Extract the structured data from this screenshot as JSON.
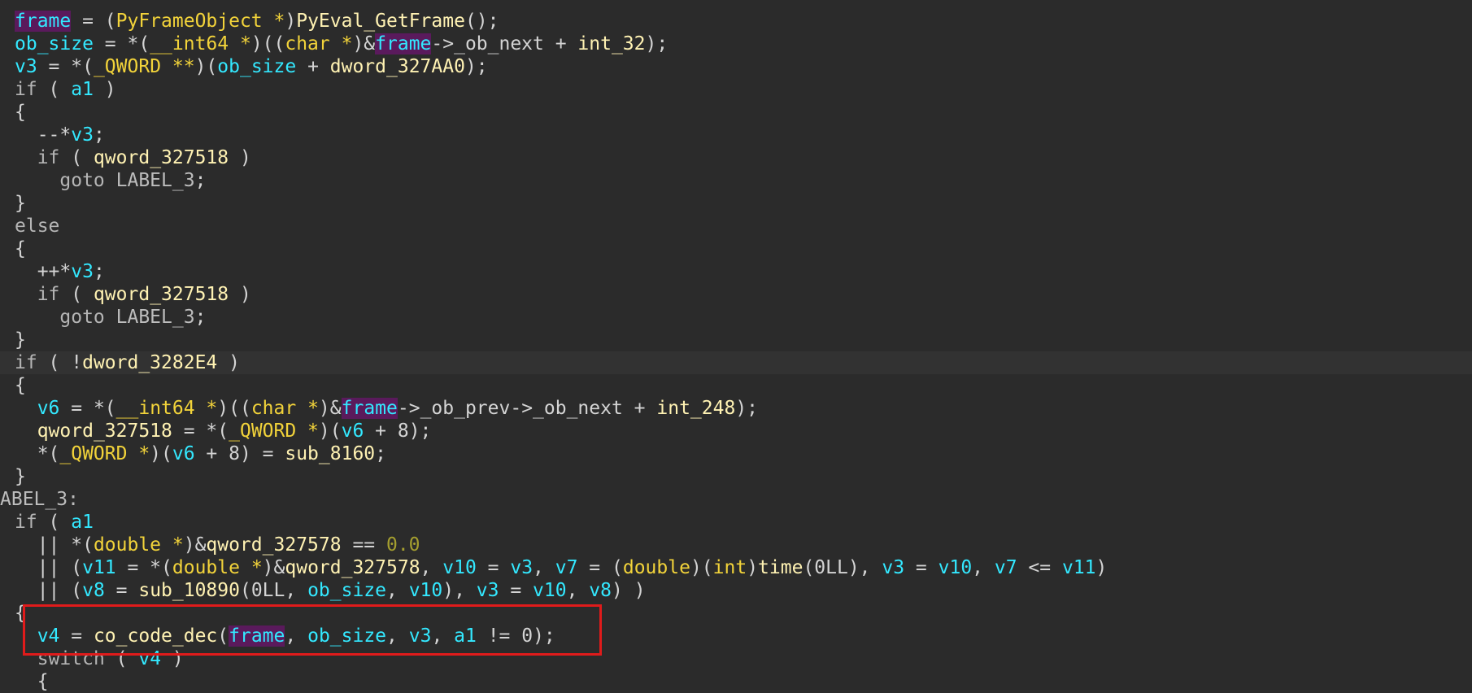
{
  "accent_colors": {
    "background": "#2b2b2b",
    "current_line": "#323232",
    "variable": "#33e8ff",
    "type": "#f2d33a",
    "identifier": "#fff2b3",
    "number": "#a59f2f",
    "keyword": "#b5b5b5",
    "highlight_bg": "#5a1a5c",
    "annotation_box": "#e01b1b"
  },
  "code_lines": [
    [
      [
        "hl",
        "frame"
      ],
      [
        "p",
        " = ("
      ],
      [
        "type",
        "PyFrameObject *"
      ],
      [
        "p",
        ")"
      ],
      [
        "id",
        "PyEval_GetFrame"
      ],
      [
        "p",
        "();"
      ]
    ],
    [
      [
        "var",
        "ob_size"
      ],
      [
        "p",
        " = *("
      ],
      [
        "type",
        "__int64 *"
      ],
      [
        "p",
        ")(("
      ],
      [
        "type",
        "char *"
      ],
      [
        "p",
        ")&"
      ],
      [
        "hl",
        "frame"
      ],
      [
        "p",
        "->_ob_next + "
      ],
      [
        "id",
        "int_32"
      ],
      [
        "p",
        ");"
      ]
    ],
    [
      [
        "var",
        "v3"
      ],
      [
        "p",
        " = *("
      ],
      [
        "type",
        "_QWORD **"
      ],
      [
        "p",
        ")("
      ],
      [
        "var",
        "ob_size"
      ],
      [
        "p",
        " + "
      ],
      [
        "id",
        "dword_327AA0"
      ],
      [
        "p",
        ");"
      ]
    ],
    [
      [
        "kw",
        "if"
      ],
      [
        "p",
        " ( "
      ],
      [
        "var",
        "a1"
      ],
      [
        "p",
        " )"
      ]
    ],
    [
      [
        "p",
        "{"
      ]
    ],
    [
      [
        "p",
        "  --*"
      ],
      [
        "var",
        "v3"
      ],
      [
        "p",
        ";"
      ]
    ],
    [
      [
        "p",
        "  "
      ],
      [
        "kw",
        "if"
      ],
      [
        "p",
        " ( "
      ],
      [
        "id",
        "qword_327518"
      ],
      [
        "p",
        " )"
      ]
    ],
    [
      [
        "p",
        "    "
      ],
      [
        "kw",
        "goto"
      ],
      [
        "p",
        " "
      ],
      [
        "lbl",
        "LABEL_3"
      ],
      [
        "p",
        ";"
      ]
    ],
    [
      [
        "p",
        "}"
      ]
    ],
    [
      [
        "kw",
        "else"
      ]
    ],
    [
      [
        "p",
        "{"
      ]
    ],
    [
      [
        "p",
        "  ++*"
      ],
      [
        "var",
        "v3"
      ],
      [
        "p",
        ";"
      ]
    ],
    [
      [
        "p",
        "  "
      ],
      [
        "kw",
        "if"
      ],
      [
        "p",
        " ( "
      ],
      [
        "id",
        "qword_327518"
      ],
      [
        "p",
        " )"
      ]
    ],
    [
      [
        "p",
        "    "
      ],
      [
        "kw",
        "goto"
      ],
      [
        "p",
        " "
      ],
      [
        "lbl",
        "LABEL_3"
      ],
      [
        "p",
        ";"
      ]
    ],
    [
      [
        "p",
        "}"
      ]
    ],
    [
      [
        "kw",
        "if"
      ],
      [
        "p",
        " ( !"
      ],
      [
        "id",
        "dword_3282E4"
      ],
      [
        "p",
        " )"
      ]
    ],
    [
      [
        "p",
        "{"
      ]
    ],
    [
      [
        "p",
        "  "
      ],
      [
        "var",
        "v6"
      ],
      [
        "p",
        " = *("
      ],
      [
        "type",
        "__int64 *"
      ],
      [
        "p",
        ")(("
      ],
      [
        "type",
        "char *"
      ],
      [
        "p",
        ")&"
      ],
      [
        "hl",
        "frame"
      ],
      [
        "p",
        "->_ob_prev->_ob_next + "
      ],
      [
        "id",
        "int_248"
      ],
      [
        "p",
        ");"
      ]
    ],
    [
      [
        "p",
        "  "
      ],
      [
        "id",
        "qword_327518"
      ],
      [
        "p",
        " = *("
      ],
      [
        "type",
        "_QWORD *"
      ],
      [
        "p",
        ")("
      ],
      [
        "var",
        "v6"
      ],
      [
        "p",
        " + 8);"
      ]
    ],
    [
      [
        "p",
        "  *("
      ],
      [
        "type",
        "_QWORD *"
      ],
      [
        "p",
        ")("
      ],
      [
        "var",
        "v6"
      ],
      [
        "p",
        " + 8) = "
      ],
      [
        "id",
        "sub_8160"
      ],
      [
        "p",
        ";"
      ]
    ],
    [
      [
        "p",
        "}"
      ]
    ],
    [
      [
        "lbl",
        "ABEL_3:"
      ]
    ],
    [
      [
        "kw",
        "if"
      ],
      [
        "p",
        " ( "
      ],
      [
        "var",
        "a1"
      ]
    ],
    [
      [
        "p",
        "  || *("
      ],
      [
        "type",
        "double *"
      ],
      [
        "p",
        ")&"
      ],
      [
        "id",
        "qword_327578"
      ],
      [
        "p",
        " == "
      ],
      [
        "num",
        "0.0"
      ]
    ],
    [
      [
        "p",
        "  || ("
      ],
      [
        "var",
        "v11"
      ],
      [
        "p",
        " = *("
      ],
      [
        "type",
        "double *"
      ],
      [
        "p",
        ")&"
      ],
      [
        "id",
        "qword_327578"
      ],
      [
        "p",
        ", "
      ],
      [
        "var",
        "v10"
      ],
      [
        "p",
        " = "
      ],
      [
        "var",
        "v3"
      ],
      [
        "p",
        ", "
      ],
      [
        "var",
        "v7"
      ],
      [
        "p",
        " = ("
      ],
      [
        "type",
        "double"
      ],
      [
        "p",
        ")("
      ],
      [
        "type",
        "int"
      ],
      [
        "p",
        ")"
      ],
      [
        "id",
        "time"
      ],
      [
        "p",
        "(0LL), "
      ],
      [
        "var",
        "v3"
      ],
      [
        "p",
        " = "
      ],
      [
        "var",
        "v10"
      ],
      [
        "p",
        ", "
      ],
      [
        "var",
        "v7"
      ],
      [
        "p",
        " <= "
      ],
      [
        "var",
        "v11"
      ],
      [
        "p",
        ")"
      ]
    ],
    [
      [
        "p",
        "  || ("
      ],
      [
        "var",
        "v8"
      ],
      [
        "p",
        " = "
      ],
      [
        "id",
        "sub_10890"
      ],
      [
        "p",
        "(0LL, "
      ],
      [
        "var",
        "ob_size"
      ],
      [
        "p",
        ", "
      ],
      [
        "var",
        "v10"
      ],
      [
        "p",
        "), "
      ],
      [
        "var",
        "v3"
      ],
      [
        "p",
        " = "
      ],
      [
        "var",
        "v10"
      ],
      [
        "p",
        ", "
      ],
      [
        "var",
        "v8"
      ],
      [
        "p",
        ") )"
      ]
    ],
    [
      [
        "p",
        "{"
      ]
    ],
    [
      [
        "p",
        "  "
      ],
      [
        "var",
        "v4"
      ],
      [
        "p",
        " = "
      ],
      [
        "id",
        "co_code_dec"
      ],
      [
        "p",
        "("
      ],
      [
        "hl",
        "frame"
      ],
      [
        "p",
        ", "
      ],
      [
        "var",
        "ob_size"
      ],
      [
        "p",
        ", "
      ],
      [
        "var",
        "v3"
      ],
      [
        "p",
        ", "
      ],
      [
        "var",
        "a1"
      ],
      [
        "p",
        " != 0);"
      ]
    ],
    [
      [
        "p",
        "  "
      ],
      [
        "kw",
        "switch"
      ],
      [
        "p",
        " ( "
      ],
      [
        "var",
        "v4"
      ],
      [
        "p",
        " )"
      ]
    ],
    [
      [
        "p",
        "  {"
      ]
    ]
  ]
}
